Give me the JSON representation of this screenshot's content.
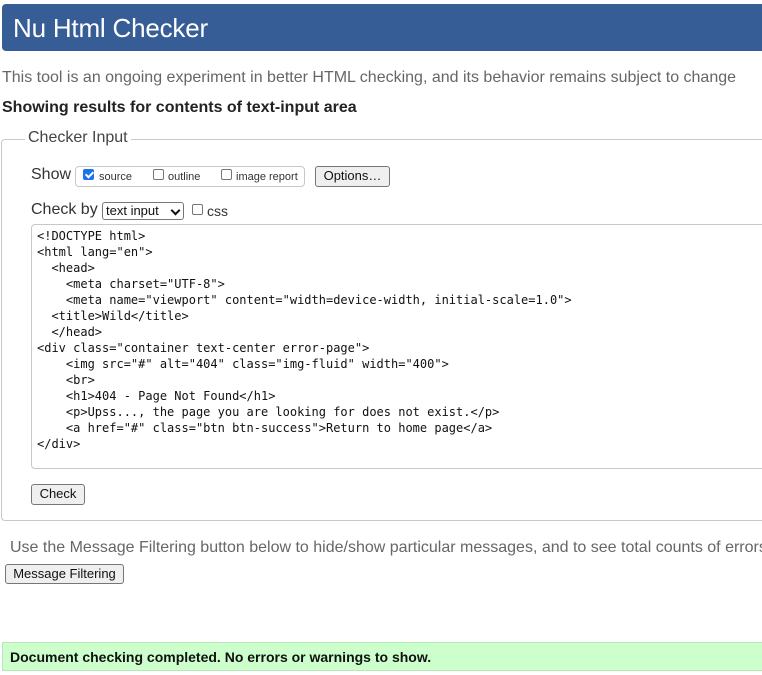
{
  "header": {
    "title": "Nu Html Checker"
  },
  "tagline": "This tool is an ongoing experiment in better HTML checking, and its behavior remains subject to change",
  "showing_results": "Showing results for contents of text-input area",
  "checker_input": {
    "legend": "Checker Input",
    "show_label": "Show",
    "options": [
      {
        "label": "source",
        "checked": true
      },
      {
        "label": "outline",
        "checked": false
      },
      {
        "label": "image report",
        "checked": false
      }
    ],
    "options_button": "Options…",
    "check_by_label": "Check by",
    "check_by_value": "text input",
    "css_label": "css",
    "css_checked": false,
    "source_code": "<!DOCTYPE html>\n<html lang=\"en\">\n  <head>\n    <meta charset=\"UTF-8\">\n    <meta name=\"viewport\" content=\"width=device-width, initial-scale=1.0\">\n  <title>Wild</title>\n  </head>\n<div class=\"container text-center error-page\">\n    <img src=\"#\" alt=\"404\" class=\"img-fluid\" width=\"400\">\n    <br>\n    <h1>404 - Page Not Found</h1>\n    <p>Upss..., the page you are looking for does not exist.</p>\n    <a href=\"#\" class=\"btn btn-success\">Return to home page</a>\n</div>",
    "check_button": "Check"
  },
  "filtering": {
    "text": "Use the Message Filtering button below to hide/show particular messages, and to see total counts of errors",
    "button": "Message Filtering"
  },
  "status": {
    "text": "Document checking completed. No errors or warnings to show."
  },
  "colors": {
    "header_bg": "#365d95",
    "status_bg": "#ccffcc",
    "accent": "#1a73e8"
  }
}
